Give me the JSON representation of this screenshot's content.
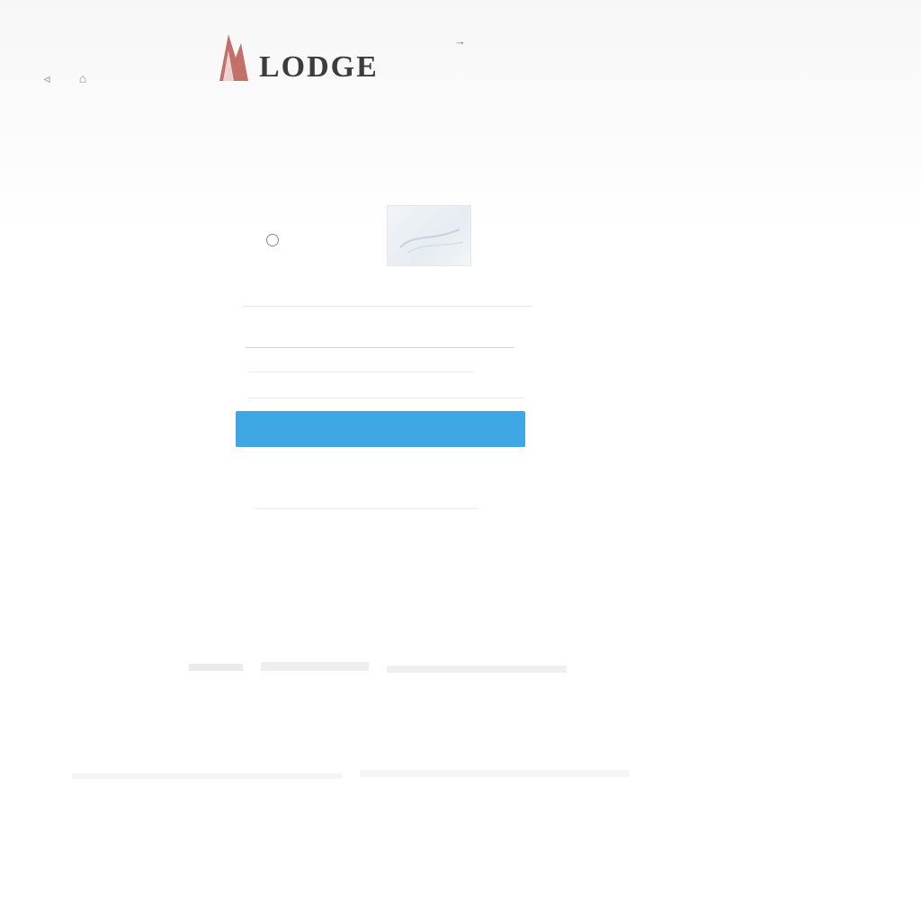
{
  "topbar": {
    "nav_icons": [
      {
        "name": "back-icon",
        "glyph": "◃"
      },
      {
        "name": "home-icon",
        "glyph": "⌂"
      }
    ]
  },
  "brand": {
    "title": "LODGE",
    "link": "→"
  },
  "colors": {
    "accent": "#3fa7e3",
    "logo_red": "#b0403a"
  }
}
